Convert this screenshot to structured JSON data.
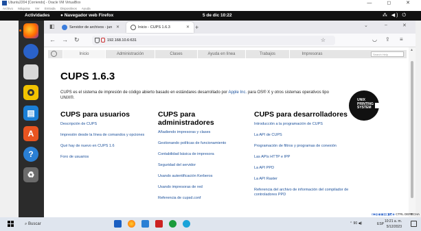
{
  "vbox": {
    "title": "Ubuntu2204 [Corriendo] - Oracle VM VirtualBox",
    "window_controls": "—  ◻  ✕",
    "menu": [
      "Archivo",
      "Máquina",
      "Ver",
      "Entrada",
      "Dispositivos",
      "Ayuda"
    ],
    "status_key": "CTRL DERECHA"
  },
  "gnome": {
    "activities": "Actividades",
    "app_name": "Navegador web Firefox",
    "clock": "5 de dic  10:22",
    "system_icons": "⁂ ◀) ⏻"
  },
  "firefox": {
    "tabs": [
      {
        "label": "Servidor de archivos - jun",
        "color": "#3b7ddd"
      },
      {
        "label": "Inicio - CUPS 1.6.3",
        "color": "#555555"
      }
    ],
    "new_tab": "+",
    "url": "192.168.10.6:631"
  },
  "cups": {
    "nav": [
      "Inicio",
      "Administración",
      "Clases",
      "Ayuda en línea",
      "Trabajos",
      "Impresoras"
    ],
    "search_placeholder": "Search Help",
    "title": "CUPS 1.6.3",
    "intro_before": "CUPS es el sistema de impresión de código abierto basado en estándares desarrollado por ",
    "intro_link": "Apple Inc.",
    "intro_after": " para OS® X y otros sistemas operativos tipo UNIX®.",
    "unix_logo": [
      "UNIX",
      "PRINTING",
      "SYSTEM"
    ],
    "columns": [
      {
        "title": "CUPS para usuarios",
        "links": [
          "Descripción de CUPS",
          "Impresión desde la línea de comandos y opciones",
          "Qué hay de nuevo en CUPS 1.6",
          "Foro de usuarios"
        ]
      },
      {
        "title": "CUPS para administradores",
        "links": [
          "Añadiendo impresoras y clases",
          "Gestionando políticas de funcionamiento",
          "Contabilidad básica de impresora",
          "Seguridad del servidor",
          "Usando autentificación Kerberos",
          "Usando impresoras de red",
          "Referencia de cupsd.conf"
        ]
      },
      {
        "title": "CUPS para desarrolladores",
        "links": [
          "Introducción a la programación de CUPS",
          "La API de CUPS",
          "Programación de filtros y programas de conexión",
          "Las APIs HTTP e IPP",
          "La API PPD",
          "La API Raster",
          "Referencia del archivo de información del compilador de controladores PPD"
        ]
      }
    ]
  },
  "taskbar": {
    "search": "Buscar",
    "tray_time": "10:21 a. m.",
    "tray_date": "5/12/2023",
    "tray_lang": "ESP",
    "tray_icons": "⌃ 90 ◀)"
  }
}
